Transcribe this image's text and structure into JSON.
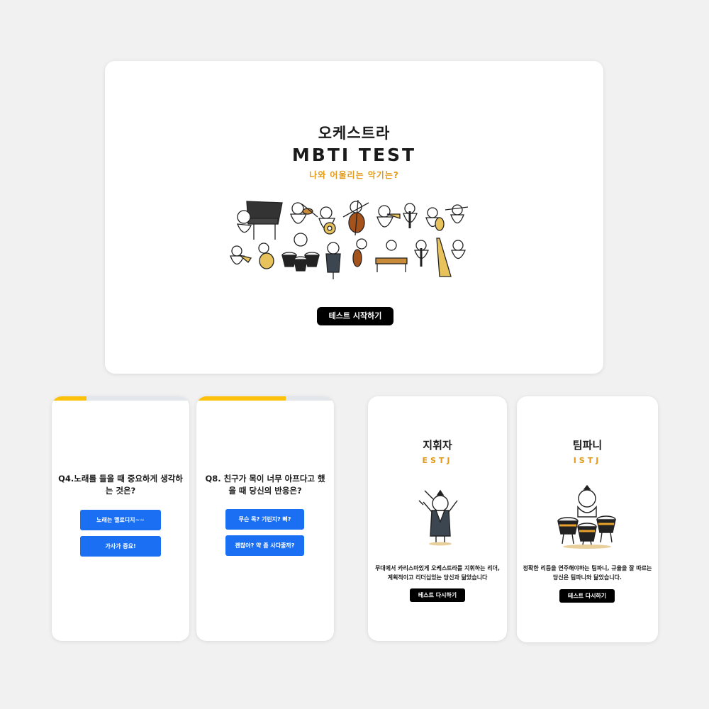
{
  "main": {
    "title_kr": "오케스트라",
    "title_en": "MBTI TEST",
    "subtitle": "나와 어울리는 악기는?",
    "start_button": "테스트 시작하기"
  },
  "questions": [
    {
      "progress": 0.25,
      "text": "Q4.노래를 들을 때 중요하게 생각하는 것은?",
      "answers": [
        "노래는 멜로디지~~",
        "가사가 중요!"
      ]
    },
    {
      "progress": 0.65,
      "text": "Q8. 친구가 목이 너무 아프다고 했을 때 당신의 반응은?",
      "answers": [
        "무슨 목? 기린지? 뼈?",
        "괜찮아? 약 좀 사다줄까?"
      ]
    }
  ],
  "results": [
    {
      "name": "지휘자",
      "type": "ESTJ",
      "description": "무대에서 카리스마있게 오케스트라를 지휘하는 리더, 계획적이고 리더십있는 당신과 닮았습니다",
      "retry_button": "테스트 다시하기"
    },
    {
      "name": "팀파니",
      "type": "ISTJ",
      "description": "정확한 리듬을 연주해야하는 팀파니, 규율을 잘 따르는 당신은 팀파니와 닮았습니다.",
      "retry_button": "테스트 다시하기"
    }
  ],
  "colors": {
    "accent_orange": "#e29a18",
    "progress_yellow": "#fcc10b",
    "answer_blue": "#1a6ff3",
    "button_black": "#000000"
  }
}
